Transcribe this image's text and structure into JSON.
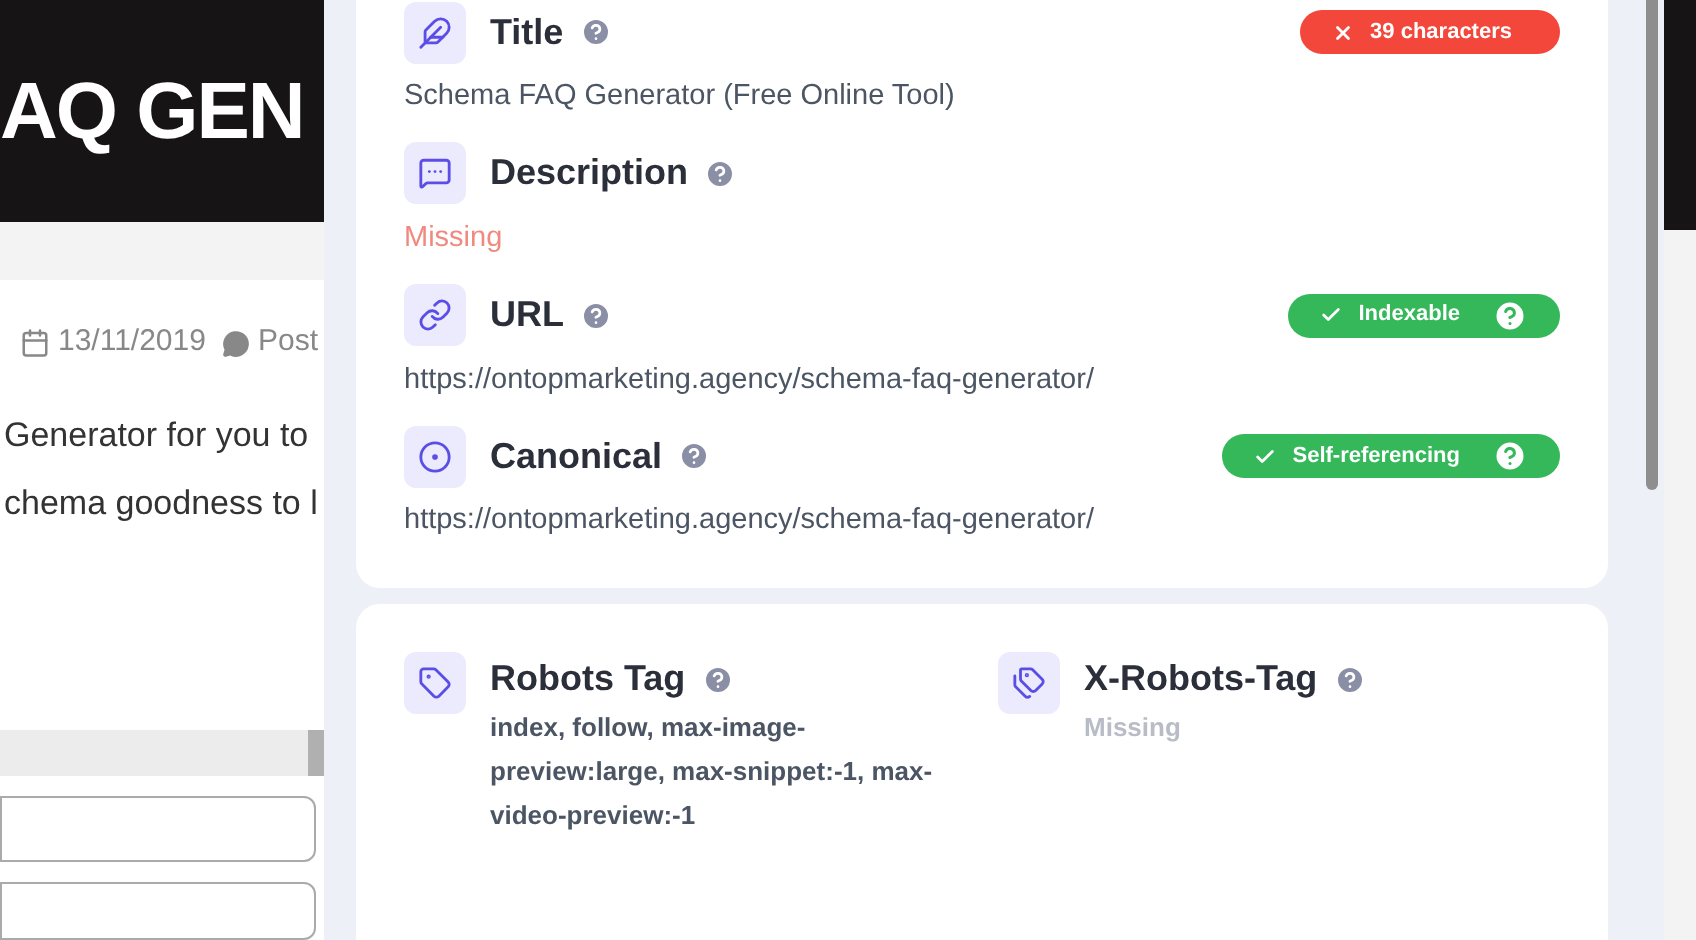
{
  "background_page": {
    "banner_title": "AQ GEN",
    "date": "13/11/2019",
    "category": "Post",
    "text_lines": [
      "Generator for you to",
      "chema goodness to l"
    ]
  },
  "seo_card": {
    "items": [
      {
        "label": "Title",
        "value": "Schema FAQ Generator (Free Online Tool)",
        "error": false,
        "badge": {
          "text": "39 characters",
          "passed": false,
          "help": false
        }
      },
      {
        "label": "Description",
        "value": "Missing",
        "error": true
      },
      {
        "label": "URL",
        "value": "https://ontopmarketing.agency/schema-faq-generator/",
        "error": false,
        "badge": {
          "text": "Indexable",
          "passed": true,
          "help": true
        }
      },
      {
        "label": "Canonical",
        "value": "https://ontopmarketing.agency/schema-faq-generator/",
        "error": false,
        "badge": {
          "text": "Self-referencing",
          "passed": true,
          "help": true
        }
      }
    ]
  },
  "robots_card": {
    "items": [
      {
        "label": "Robots Tag",
        "value": "index, follow, max-image-preview:large, max-snippet:-1, max-video-preview:-1",
        "missing": false
      },
      {
        "label": "X-Robots-Tag",
        "value": "Missing",
        "missing": true
      }
    ]
  }
}
